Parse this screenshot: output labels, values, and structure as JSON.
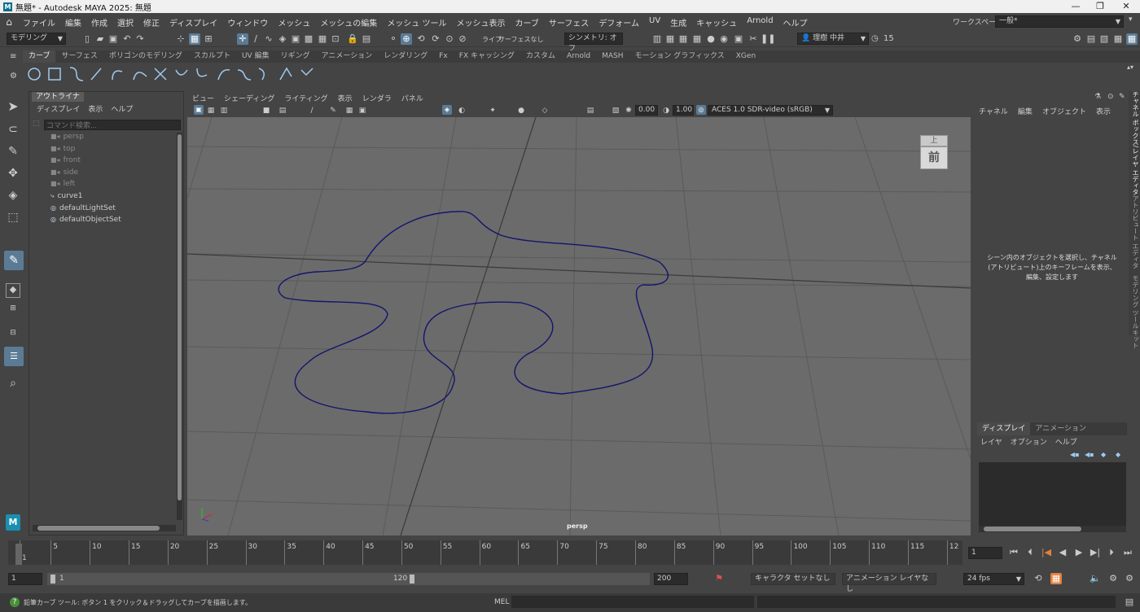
{
  "window": {
    "title": "無題* - Autodesk MAYA 2025: 無題",
    "logo": "M"
  },
  "menu": [
    "ファイル",
    "編集",
    "作成",
    "選択",
    "修正",
    "ディスプレイ",
    "ウィンドウ",
    "メッシュ",
    "メッシュの編集",
    "メッシュ ツール",
    "メッシュ表示",
    "カーブ",
    "サーフェス",
    "デフォーム",
    "UV",
    "生成",
    "キャッシュ",
    "Arnold",
    "ヘルプ"
  ],
  "workspace": {
    "label": "ワークスペース :",
    "value": "一般*"
  },
  "statusline": {
    "mode": "モデリング",
    "live": "ライブ",
    "live_value": "サーフェスなし",
    "symmetry": "シンメトリ: オフ",
    "user": "理樹 中井",
    "credits": "15"
  },
  "shelf_tabs": [
    "カーブ",
    "サーフェス",
    "ポリゴンのモデリング",
    "スカルプト",
    "UV 編集",
    "リギング",
    "アニメーション",
    "レンダリング",
    "Fx",
    "FX キャッシング",
    "カスタム",
    "Arnold",
    "MASH",
    "モーション グラフィックス",
    "XGen"
  ],
  "shelf_active": 0,
  "outliner": {
    "tab": "アウトライナ",
    "menu": [
      "ディスプレイ",
      "表示",
      "ヘルプ"
    ],
    "search_placeholder": "コマンド検索...",
    "items": [
      {
        "label": "persp",
        "icon": "camera-icon",
        "dim": true
      },
      {
        "label": "top",
        "icon": "camera-icon",
        "dim": true
      },
      {
        "label": "front",
        "icon": "camera-icon",
        "dim": true
      },
      {
        "label": "side",
        "icon": "camera-icon",
        "dim": true
      },
      {
        "label": "left",
        "icon": "camera-icon",
        "dim": true
      },
      {
        "label": "curve1",
        "icon": "curve-icon",
        "dim": false
      },
      {
        "label": "defaultLightSet",
        "icon": "set-icon",
        "dim": false
      },
      {
        "label": "defaultObjectSet",
        "icon": "set-icon",
        "dim": false
      }
    ]
  },
  "panel_menu": [
    "ビュー",
    "シェーディング",
    "ライティング",
    "表示",
    "レンダラ",
    "パネル"
  ],
  "panel_toolbar": {
    "exposure": "0.00",
    "gamma": "1.00",
    "colorspace": "ACES 1.0 SDR-video (sRGB)"
  },
  "viewport": {
    "camera_label": "persp",
    "viewcube_top": "上",
    "viewcube_front": "前"
  },
  "channelbox": {
    "menu": [
      "チャネル",
      "編集",
      "オブジェクト",
      "表示"
    ],
    "message_line1": "シーン内のオブジェクトを選択し、チャネル",
    "message_line2": "(アトリビュート)上のキーフレームを表示、",
    "message_line3": "編集、設定します"
  },
  "side_tabs": [
    "チャネル ボックス/レイヤ エディタ",
    "アトリビュート エディタ",
    "モデリング ツールキット"
  ],
  "layer_editor": {
    "tabs": [
      "ディスプレイ",
      "アニメーション"
    ],
    "menu": [
      "レイヤ",
      "オプション",
      "ヘルプ"
    ]
  },
  "timeline": {
    "ticks": [
      "1",
      "5",
      "10",
      "15",
      "20",
      "25",
      "30",
      "35",
      "40",
      "45",
      "50",
      "55",
      "60",
      "65",
      "70",
      "75",
      "80",
      "85",
      "90",
      "95",
      "100",
      "105",
      "110",
      "115",
      "12"
    ],
    "current": "1"
  },
  "range": {
    "start": "1",
    "inner_start": "1",
    "inner_end": "120",
    "end": "200",
    "character": "キャラクタ セットなし",
    "anim_layer": "アニメーション レイヤなし",
    "fps": "24 fps"
  },
  "help": {
    "text": "鉛筆カーブ ツール: ボタン 1 をクリック＆ドラッグしてカーブを描画します。",
    "mel": "MEL"
  },
  "colors": {
    "accent": "#5b7b95",
    "curve": "#14146e",
    "viewport": "#6b6b6b"
  }
}
